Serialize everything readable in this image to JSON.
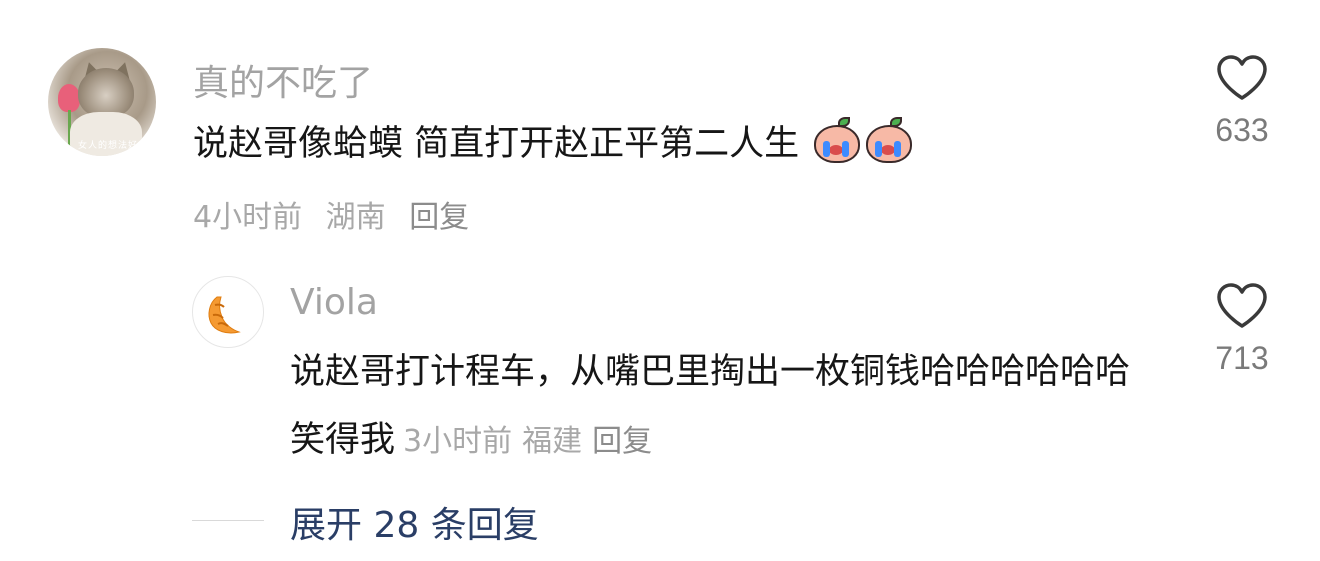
{
  "main_comment": {
    "username": "真的不吃了",
    "text": "说赵哥像蛤蟆 简直打开赵正平第二人生",
    "emojis": [
      "crying-face-emoji",
      "crying-face-emoji"
    ],
    "avatar_watermark": "女人的想法好",
    "time": "4小时前",
    "location": "湖南",
    "reply_label": "回复",
    "like_icon": "heart-outline-icon",
    "like_count": "633"
  },
  "reply_comment": {
    "username": "Viola",
    "avatar_icon": "croissant-icon",
    "text": "说赵哥打计程车，从嘴巴里掏出一枚铜钱哈哈哈哈哈哈笑得我",
    "time": "3小时前",
    "location": "福建",
    "reply_label": "回复",
    "like_icon": "heart-outline-icon",
    "like_count": "713"
  },
  "expand": {
    "label": "展开 28 条回复"
  },
  "colors": {
    "username": "#a3a3a3",
    "text": "#161616",
    "meta": "#a8a8a8",
    "expand": "#2a3e66",
    "croissant": "#f59a32"
  }
}
